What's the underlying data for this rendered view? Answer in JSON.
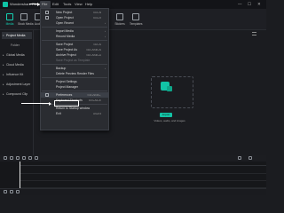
{
  "window": {
    "app_title": "Wondershare Filmora",
    "menu": [
      "File",
      "Edit",
      "Tools",
      "View",
      "Help"
    ],
    "controls": [
      "—",
      "☐",
      "✕"
    ]
  },
  "toolbar": {
    "buttons": [
      {
        "label": "Media",
        "icon": "media-icon",
        "active": true
      },
      {
        "label": "Stock Media",
        "icon": "stock-media-icon",
        "active": false
      },
      {
        "label": "Audio",
        "icon": "audio-icon",
        "active": false
      },
      {
        "label": "Stickers",
        "icon": "stickers-icon",
        "active": false
      },
      {
        "label": "Templates",
        "icon": "templates-icon",
        "active": false
      }
    ]
  },
  "sidebar": {
    "items": [
      {
        "label": "Project Media",
        "active": true,
        "child": false
      },
      {
        "label": "Folder",
        "active": false,
        "child": true
      },
      {
        "label": "Global Media",
        "active": false,
        "child": false
      },
      {
        "label": "Cloud Media",
        "active": false,
        "child": false
      },
      {
        "label": "Influence Kit",
        "active": false,
        "child": false
      },
      {
        "label": "Adjustment Layer",
        "active": false,
        "child": false
      },
      {
        "label": "Compound Clip",
        "active": false,
        "child": false
      }
    ]
  },
  "file_menu": {
    "items": [
      {
        "label": "New Project",
        "shortcut": "Ctrl+N",
        "submenu": false,
        "disabled": false
      },
      {
        "label": "Open Project",
        "shortcut": "Ctrl+O",
        "submenu": false,
        "disabled": false
      },
      {
        "label": "Open Recent",
        "shortcut": "",
        "submenu": true,
        "disabled": false
      },
      {
        "sep": true
      },
      {
        "label": "Import Media",
        "shortcut": "",
        "submenu": true,
        "disabled": false
      },
      {
        "label": "Record Media",
        "shortcut": "",
        "submenu": true,
        "disabled": false
      },
      {
        "sep": true
      },
      {
        "label": "Save Project",
        "shortcut": "Ctrl+S",
        "submenu": false,
        "disabled": false
      },
      {
        "label": "Save Project As",
        "shortcut": "Ctrl+Shift+S",
        "submenu": false,
        "disabled": false
      },
      {
        "label": "Archive Project",
        "shortcut": "Ctrl+Shift+A",
        "submenu": false,
        "disabled": false
      },
      {
        "label": "Save Project as Template",
        "shortcut": "",
        "submenu": false,
        "disabled": true
      },
      {
        "sep": true
      },
      {
        "label": "Backup",
        "shortcut": "",
        "submenu": true,
        "disabled": false
      },
      {
        "label": "Delete Preview Render Files",
        "shortcut": "",
        "submenu": false,
        "disabled": false
      },
      {
        "sep": true
      },
      {
        "label": "Project Settings",
        "shortcut": "",
        "submenu": false,
        "disabled": false
      },
      {
        "label": "Project Manager",
        "shortcut": "",
        "submenu": false,
        "disabled": false
      },
      {
        "sep": true
      },
      {
        "label": "Preferences",
        "shortcut": "Ctrl+Shift+,",
        "submenu": false,
        "disabled": false,
        "highlight": true
      },
      {
        "label": "Keyboard Shortcuts",
        "shortcut": "Ctrl+Alt+K",
        "submenu": false,
        "disabled": false
      },
      {
        "sep": true
      },
      {
        "label": "Return to Startup window",
        "shortcut": "",
        "submenu": false,
        "disabled": false
      },
      {
        "label": "Exit",
        "shortcut": "Alt+F4",
        "submenu": false,
        "disabled": false
      }
    ]
  },
  "media": {
    "import_label": "Import",
    "drop_hint": "Videos, audio, and images"
  },
  "timeline": {
    "track_labels": [
      "",
      "",
      ""
    ]
  },
  "colors": {
    "accent": "#13c3a5",
    "background": "#1b1c20",
    "menu_bg": "#2a2c31"
  }
}
